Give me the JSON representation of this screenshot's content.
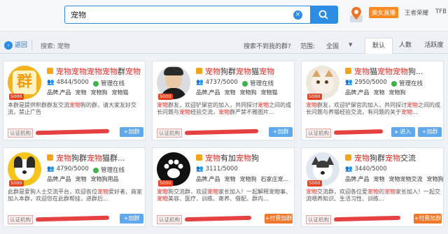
{
  "search": {
    "value": "宠物",
    "clear_symbol": "×"
  },
  "header": {
    "promo": "美女直播",
    "game_link": "王者荣耀",
    "tfb_link": "TFB"
  },
  "toolbar": {
    "back": "返回",
    "back_symbol": "‹",
    "keyword_label": "搜索: 宠物",
    "cant_find": "搜索不到我的群?",
    "range_label": "范围:",
    "range_value": "全国",
    "range_arrow": "▼",
    "tabs": [
      "默认",
      "人数",
      "活跃度"
    ]
  },
  "colors": {
    "accent": "#2c8de3",
    "highlight": "#e5261f",
    "pay": "#f0782a",
    "online": "#3fb24a"
  },
  "cards": [
    {
      "title_parts": [
        "宠物宠物宠物宠物",
        "群",
        "宠物"
      ],
      "members": "4844/5000",
      "online": "管理在线",
      "tags": [
        "品牌,产品",
        "宠物",
        "宠物狗",
        "宠物猫"
      ],
      "desc_parts": [
        "本群是提供积群群友交流",
        "宠物",
        "狗的群，请大家友好交流，禁止广告"
      ],
      "badge": "5000",
      "cert": "认证机构",
      "join": "+加群",
      "avatar_text": "群"
    },
    {
      "title_parts": [
        "宠物",
        "狗群",
        "宠物",
        "猫",
        "宠物"
      ],
      "members": "4737/5000",
      "online": "管理在线",
      "tags": [
        "品牌,产品",
        "宠物",
        "宠物狗",
        "宠物猫"
      ],
      "desc_parts": [
        "宠物",
        "群友，欢迎铲屎官的加入，共同探讨",
        "宠物",
        "之间的成长问题与",
        "宠物",
        "经验交流，",
        "宠物",
        "群严禁不雅图片..."
      ],
      "badge": "5000",
      "cert": "认证机构",
      "join": "+加群"
    },
    {
      "title_parts": [
        "宠物",
        "猫",
        "宠物宠物",
        "狗..."
      ],
      "members": "2950/5000",
      "online": "管理在线",
      "tags": [
        "品牌,产品",
        "宠物",
        "宠物狗"
      ],
      "desc_parts": [
        "宠物",
        "群友，欢迎铲屎官的加入，共同探讨",
        "宠物",
        "之间的成长问题与养猫经验交流，有问题的关于",
        "宠物",
        "..."
      ],
      "badge": "5000",
      "cert": "认证机构",
      "enter": "▸ 进入",
      "join": "+加群"
    },
    {
      "title_parts": [
        "宠物",
        "狗群",
        "宠物",
        "猫群..."
      ],
      "members": "4790/5000",
      "online": "管理在线",
      "tags": [
        "品牌,产品",
        "宠物",
        "宠物狗用品"
      ],
      "desc_parts": [
        "此群是爱狗人士交流平台，欢迎各位",
        "宠物",
        "爱好者、商家加入本群，欢迎您在此群帮挂，进群后..."
      ],
      "badge": "5000",
      "cert": "认证机构",
      "join": "+加群"
    },
    {
      "title_parts": [
        "宠物",
        "有加",
        "宠物",
        "狗"
      ],
      "members": "3111/5000",
      "online": "",
      "tags": [
        "品牌,产品",
        "宠物",
        "宠物狗",
        "石家庄宠..."
      ],
      "desc_parts": [
        "宠物",
        "狗交流群，欢迎",
        "宠物",
        "家长加入！一起解释宠物事、",
        "宠物",
        "美容、医疗、训练、寄养、借配、群内..."
      ],
      "badge": "5000",
      "cert": "认证机构",
      "join": "+付费加群"
    },
    {
      "title_parts": [
        "宠物",
        "狗群",
        "宠物",
        "交流"
      ],
      "members": "3440/5000",
      "online": "",
      "tags": [
        "品牌,产品",
        "宠物",
        "宠物宠物交流",
        "宠物狗"
      ],
      "desc_parts": [
        "宠物",
        "交流群，欢迎各位爱",
        "宠物",
        "的",
        "宠物",
        "家长加入！一起交流喂养知识、生活习性、训练..."
      ],
      "badge": "5000",
      "cert": "认证机构",
      "join": "+付费加群"
    }
  ]
}
